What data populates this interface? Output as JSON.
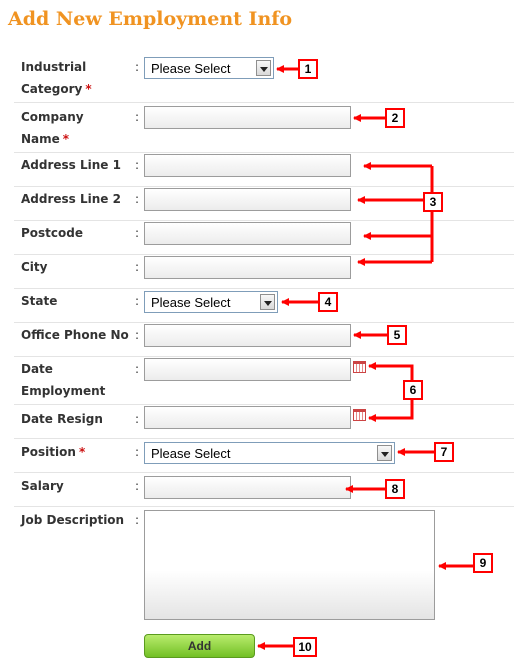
{
  "page": {
    "title": "Add New Employment Info"
  },
  "form": {
    "separator": ":",
    "required_mark": "*",
    "industrial_category": {
      "label_line1": "Industrial",
      "label_line2": "Category",
      "value": "Please Select"
    },
    "company_name": {
      "label_line1": "Company",
      "label_line2": "Name",
      "value": ""
    },
    "address_line_1": {
      "label": "Address Line 1",
      "value": ""
    },
    "address_line_2": {
      "label": "Address Line 2",
      "value": ""
    },
    "postcode": {
      "label": "Postcode",
      "value": ""
    },
    "city": {
      "label": "City",
      "value": ""
    },
    "state": {
      "label": "State",
      "value": "Please Select"
    },
    "office_phone": {
      "label": "Office Phone No",
      "value": ""
    },
    "date_employment": {
      "label_line1": "Date",
      "label_line2": "Employment",
      "value": ""
    },
    "date_resign": {
      "label": "Date Resign",
      "value": ""
    },
    "position": {
      "label": "Position",
      "value": "Please Select"
    },
    "salary": {
      "label": "Salary",
      "value": ""
    },
    "job_description": {
      "label": "Job Description",
      "value": ""
    },
    "add_button": "Add"
  },
  "callouts": [
    "1",
    "2",
    "3",
    "4",
    "5",
    "6",
    "7",
    "8",
    "9",
    "10"
  ],
  "colors": {
    "title": "#f09321",
    "required": "#cc1111",
    "callout": "#ff0000",
    "add_button": "#8fd43f"
  },
  "icons": {
    "dropdown": "chevron-down-icon",
    "calendar": "calendar-icon"
  }
}
